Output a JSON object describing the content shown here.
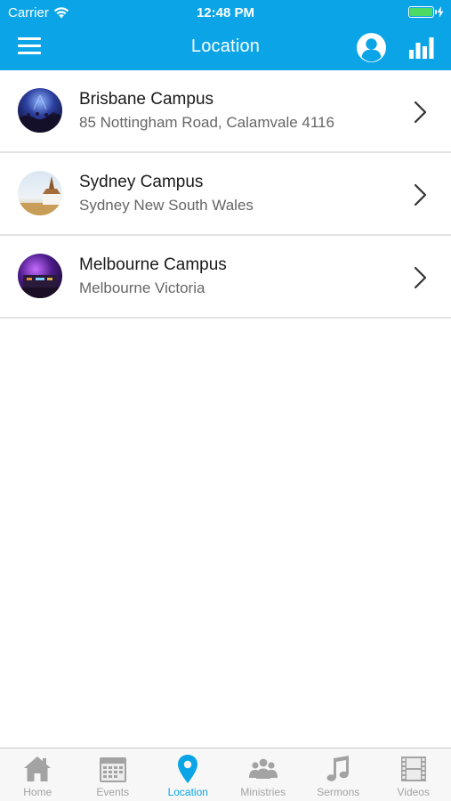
{
  "status_bar": {
    "carrier": "Carrier",
    "time": "12:48 PM",
    "battery_color": "#4cd964"
  },
  "nav": {
    "title": "Location",
    "menu_icon": "hamburger-menu-icon",
    "profile_icon": "user-profile-icon",
    "stats_icon": "bar-chart-icon",
    "bar_color": "#0ba5e7"
  },
  "locations": [
    {
      "name": "Brisbane Campus",
      "address": "85 Nottingham Road, Calamvale 4116",
      "thumb": "concert-stage-image"
    },
    {
      "name": "Sydney Campus",
      "address": "Sydney New South Wales",
      "thumb": "church-building-image"
    },
    {
      "name": "Melbourne Campus",
      "address": "Melbourne Victoria",
      "thumb": "purple-stage-image"
    }
  ],
  "tabs": [
    {
      "label": "Home",
      "icon": "home-icon",
      "active": false
    },
    {
      "label": "Events",
      "icon": "calendar-icon",
      "active": false
    },
    {
      "label": "Location",
      "icon": "location-pin-icon",
      "active": true
    },
    {
      "label": "Ministries",
      "icon": "people-icon",
      "active": false
    },
    {
      "label": "Sermons",
      "icon": "music-note-icon",
      "active": false
    },
    {
      "label": "Videos",
      "icon": "film-strip-icon",
      "active": false
    }
  ],
  "colors": {
    "accent": "#0ba5e7",
    "inactive_tab": "#a3a3a3"
  }
}
